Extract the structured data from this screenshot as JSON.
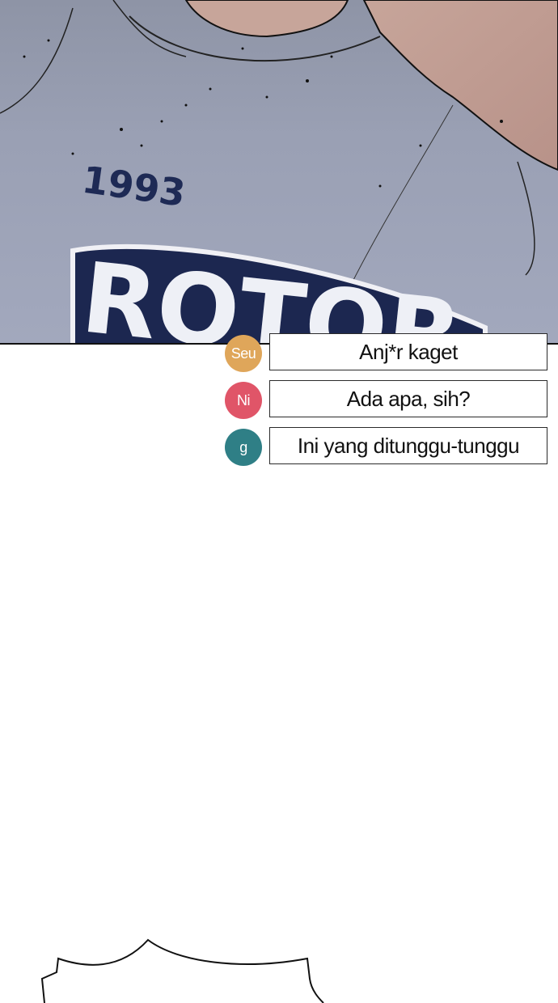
{
  "panel": {
    "shirt_number": "1993",
    "shirt_logo_partial": "ROTOR"
  },
  "comments": [
    {
      "avatar_text": "Seu",
      "avatar_color": "#dfa65a",
      "text": "Anj*r kaget"
    },
    {
      "avatar_text": "Ni",
      "avatar_color": "#e05568",
      "text": "Ada apa, sih?"
    },
    {
      "avatar_text": "g",
      "avatar_color": "#2f7f86",
      "text": "Ini yang ditunggu-tunggu"
    }
  ]
}
